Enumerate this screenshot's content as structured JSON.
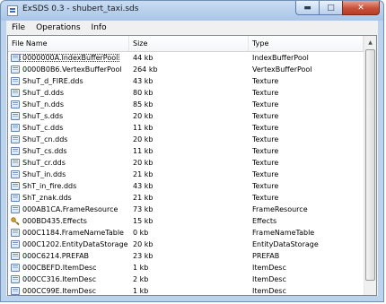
{
  "window": {
    "title": "ExSDS 0.3 - shubert_taxi.sds"
  },
  "menu": [
    {
      "label": "File"
    },
    {
      "label": "Operations"
    },
    {
      "label": "Info"
    }
  ],
  "columns": {
    "name": "File Name",
    "size": "Size",
    "type": "Type"
  },
  "files": [
    {
      "name": "0000000A.IndexBufferPool",
      "size": "44 kb",
      "type": "IndexBufferPool",
      "icon": "file-icon"
    },
    {
      "name": "0000B0B6.VertexBufferPool",
      "size": "264 kb",
      "type": "VertexBufferPool",
      "icon": "file-icon"
    },
    {
      "name": "ShuT_d_FIRE.dds",
      "size": "43 kb",
      "type": "Texture",
      "icon": "file-icon"
    },
    {
      "name": "ShuT_d.dds",
      "size": "80 kb",
      "type": "Texture",
      "icon": "file-icon"
    },
    {
      "name": "ShuT_n.dds",
      "size": "85 kb",
      "type": "Texture",
      "icon": "file-icon"
    },
    {
      "name": "ShuT_s.dds",
      "size": "20 kb",
      "type": "Texture",
      "icon": "file-icon"
    },
    {
      "name": "ShuT_c.dds",
      "size": "11 kb",
      "type": "Texture",
      "icon": "file-icon"
    },
    {
      "name": "ShuT_cn.dds",
      "size": "20 kb",
      "type": "Texture",
      "icon": "file-icon"
    },
    {
      "name": "ShuT_cs.dds",
      "size": "11 kb",
      "type": "Texture",
      "icon": "file-icon"
    },
    {
      "name": "ShuT_cr.dds",
      "size": "20 kb",
      "type": "Texture",
      "icon": "file-icon"
    },
    {
      "name": "ShuT_in.dds",
      "size": "21 kb",
      "type": "Texture",
      "icon": "file-icon"
    },
    {
      "name": "ShT_in_fire.dds",
      "size": "43 kb",
      "type": "Texture",
      "icon": "file-icon"
    },
    {
      "name": "ShT_znak.dds",
      "size": "21 kb",
      "type": "Texture",
      "icon": "file-icon"
    },
    {
      "name": "000AB1CA.FrameResource",
      "size": "73 kb",
      "type": "FrameResource",
      "icon": "file-icon"
    },
    {
      "name": "000BD435.Effects",
      "size": "15 kb",
      "type": "Effects",
      "icon": "key-icon"
    },
    {
      "name": "000C1184.FrameNameTable",
      "size": "0 kb",
      "type": "FrameNameTable",
      "icon": "file-icon"
    },
    {
      "name": "000C1202.EntityDataStorage",
      "size": "20 kb",
      "type": "EntityDataStorage",
      "icon": "file-icon"
    },
    {
      "name": "000C6214.PREFAB",
      "size": "23 kb",
      "type": "PREFAB",
      "icon": "file-icon"
    },
    {
      "name": "000CBEFD.ItemDesc",
      "size": "1 kb",
      "type": "ItemDesc",
      "icon": "file-icon"
    },
    {
      "name": "000CC316.ItemDesc",
      "size": "2 kb",
      "type": "ItemDesc",
      "icon": "file-icon"
    },
    {
      "name": "000CC99E.ItemDesc",
      "size": "1 kb",
      "type": "ItemDesc",
      "icon": "file-icon"
    }
  ]
}
